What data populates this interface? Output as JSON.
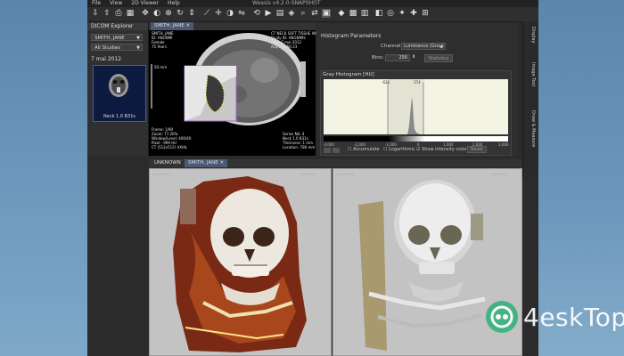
{
  "window": {
    "title": "Weasis v4.2.0-SNAPSHOT"
  },
  "menu": [
    "File",
    "View",
    "2D Viewer",
    "Help"
  ],
  "dicom_explorer": {
    "title": "DICOM Explorer",
    "patient": "SMITH, JANE",
    "studies": "All Studies",
    "date": "7 mai 2012",
    "thumb_label": "Neck 1.0 B31s"
  },
  "ct_view": {
    "tab": "SMITH, JANE",
    "top_left": "SMITH, JANE\nID: ANONMI\nFemale\n75 Years",
    "top_right": "CT NECK SOFT TISSUE W/ C...\nStudy ID: ANONMIS\nAcq.: 7 mai 2012\nAcq.: 15:56:33",
    "bottom_left": "Frame: 1/90\nZoom: 77.20%\nWindow/Level: 400/40\nPixel: -999 HU\nCT (512x512) AXIAL",
    "bottom_right": "Series Nb: 4\nNeck 1.0 B31s\nThickness: 1 mm\nLocation: 786 mm",
    "scale_label": "50 mm"
  },
  "histogram": {
    "title": "Histogram Parameters",
    "channel_label": "Channel:",
    "channel_value": "Luminance (Gray)",
    "bins_label": "Bins:",
    "bins_value": "256",
    "statistics_button": "Statistics",
    "box_title": "Gray Histogram [HU]",
    "marker_low": "-626",
    "marker_high": "374",
    "ticks": [
      "-3,000",
      "-2,000",
      "-1,000",
      "0",
      "1,000",
      "2,000",
      "3,000"
    ],
    "accumulate": "Accumulate",
    "logarithmic": "Logarithmic",
    "show_intensity": "Show intensity color",
    "reset_button": "Reset"
  },
  "side_tabs": [
    "Display",
    "Image Tool",
    "Draw & Measure"
  ],
  "view_tabs": {
    "first": "UNKNOWN",
    "second": "SMITH, JANE"
  },
  "watermark": "4eskTop",
  "colors": {
    "accent": "#3b5cb4",
    "tab_active": "#4b5a72",
    "watermark": "#37b27c"
  }
}
